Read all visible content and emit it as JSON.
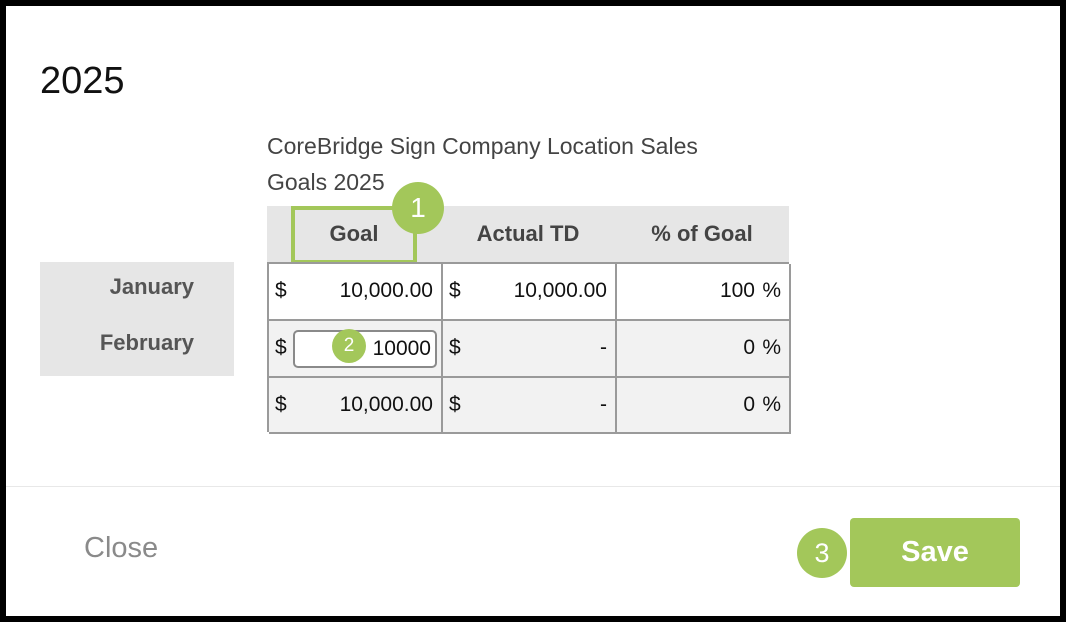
{
  "modal": {
    "title": "2025"
  },
  "table": {
    "title": "CoreBridge Sign Company Location Sales Goals 2025",
    "headers": {
      "goal": "Goal",
      "actual": "Actual TD",
      "percent": "% of Goal"
    },
    "rows": [
      {
        "label": "January",
        "currency_goal": "$",
        "goal": "10,000.00",
        "currency_actual": "$",
        "actual": "10,000.00",
        "percent": "100",
        "percent_sign": "%"
      },
      {
        "label": "February",
        "currency_goal": "$",
        "goal_input_value": "10000",
        "currency_actual": "$",
        "actual": "-",
        "percent": "0",
        "percent_sign": "%"
      },
      {
        "label": "",
        "currency_goal": "$",
        "goal": "10,000.00",
        "currency_actual": "$",
        "actual": "-",
        "percent": "0",
        "percent_sign": "%"
      }
    ]
  },
  "callouts": {
    "one": "1",
    "two": "2",
    "three": "3"
  },
  "footer": {
    "close_label": "Close",
    "save_label": "Save"
  },
  "colors": {
    "accent": "#a3c75a",
    "header_bg": "#e6e6e6",
    "cell_bg": "#f2f2f2",
    "frame": "#000000"
  }
}
